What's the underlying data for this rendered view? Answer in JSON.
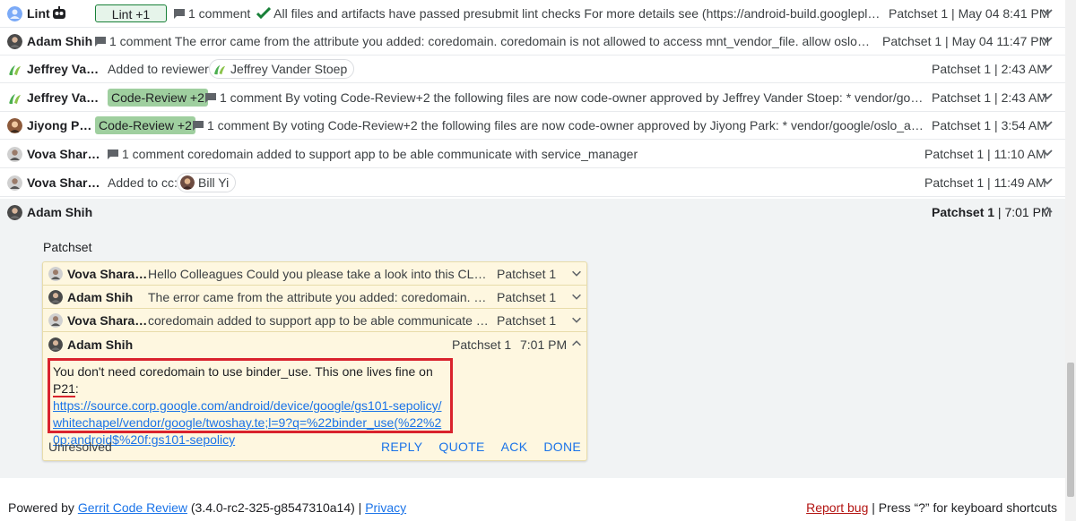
{
  "colors": {
    "link": "#1a73e8",
    "approved_vote": "#9fcf9f",
    "highlight_box": "#d9232d",
    "thread_bg": "#fef7e0"
  },
  "messages": [
    {
      "author": "Lint",
      "vote": "Lint +1",
      "summary": "1 comment",
      "text": "All files and artifacts have passed presubmit lint checks For more details see (https://android-build.googleplex.c...",
      "meta": "Patchset 1 | May 04 8:41 PM"
    },
    {
      "author": "Adam Shih",
      "summary": "1 comment",
      "text": "The error came from the attribute you added: coredomain. coredomain is not allowed to access mnt_vendor_file. allow oslo_app ...",
      "meta": "Patchset 1 | May 04 11:47 PM"
    },
    {
      "author": "Jeffrey Van...",
      "prefix": "Added to reviewer:",
      "chip": "Jeffrey Vander Stoep",
      "meta": "Patchset 1 | 2:43 AM"
    },
    {
      "author": "Jeffrey Van...",
      "vote": "Code-Review +2",
      "summary": "1 comment",
      "text": "By voting Code-Review+2 the following files are now code-owner approved by Jeffrey Vander Stoep: * vendor/google/...",
      "meta": "Patchset 1 | 2:43 AM"
    },
    {
      "author": "Jiyong Park",
      "vote": "Code-Review +2",
      "summary": "1 comment",
      "text": "By voting Code-Review+2 the following files are now code-owner approved by Jiyong Park: * vendor/google/oslo_app.te",
      "meta": "Patchset 1 | 3:54 AM"
    },
    {
      "author": "Vova Sharai...",
      "summary": "1 comment",
      "text": "coredomain added to support app to be able communicate with service_manager",
      "meta": "Patchset 1 | 11:10 AM"
    },
    {
      "author": "Vova Sharai...",
      "prefix": "Added to cc:",
      "chip": "Bill Yi",
      "meta": "Patchset 1 | 11:49 AM"
    }
  ],
  "expanded": {
    "author": "Adam Shih",
    "meta_patchset": "Patchset 1",
    "meta_sep": " | ",
    "meta_time": "7:01 PM",
    "patchset_label": "Patchset",
    "thread": [
      {
        "author": "Vova Sharaie...",
        "summary": "Hello Colleagues Could you please take a look into this CL? I d...",
        "patchset": "Patchset 1"
      },
      {
        "author": "Adam Shih",
        "summary": "The error came from the attribute you added: coredomain. core...",
        "patchset": "Patchset 1"
      },
      {
        "author": "Vova Sharaie...",
        "summary": "coredomain added to support app to be able communicate wit...",
        "patchset": "Patchset 1"
      }
    ],
    "comment": {
      "author": "Adam Shih",
      "patchset": "Patchset 1",
      "time": "7:01 PM",
      "text_before": "You don't need coredomain to use binder_use. This one lives fine on ",
      "highlight": "P21",
      "text_after": ":",
      "link": "https://source.corp.google.com/android/device/google/gs101-sepolicy/whitechapel/vendor/google/twoshay.te;l=9?q=%22binder_use(%22%20p:android$%20f:gs101-sepolicy",
      "status": "Unresolved",
      "actions": {
        "reply": "REPLY",
        "quote": "QUOTE",
        "ack": "ACK",
        "done": "DONE"
      }
    }
  },
  "footer": {
    "powered_by": "Powered by ",
    "gerrit_link": "Gerrit Code Review",
    "version": " (3.4.0-rc2-325-g8547310a14) | ",
    "privacy": "Privacy",
    "report_bug": "Report bug",
    "shortcuts_hint": " | Press “?” for keyboard shortcuts"
  }
}
